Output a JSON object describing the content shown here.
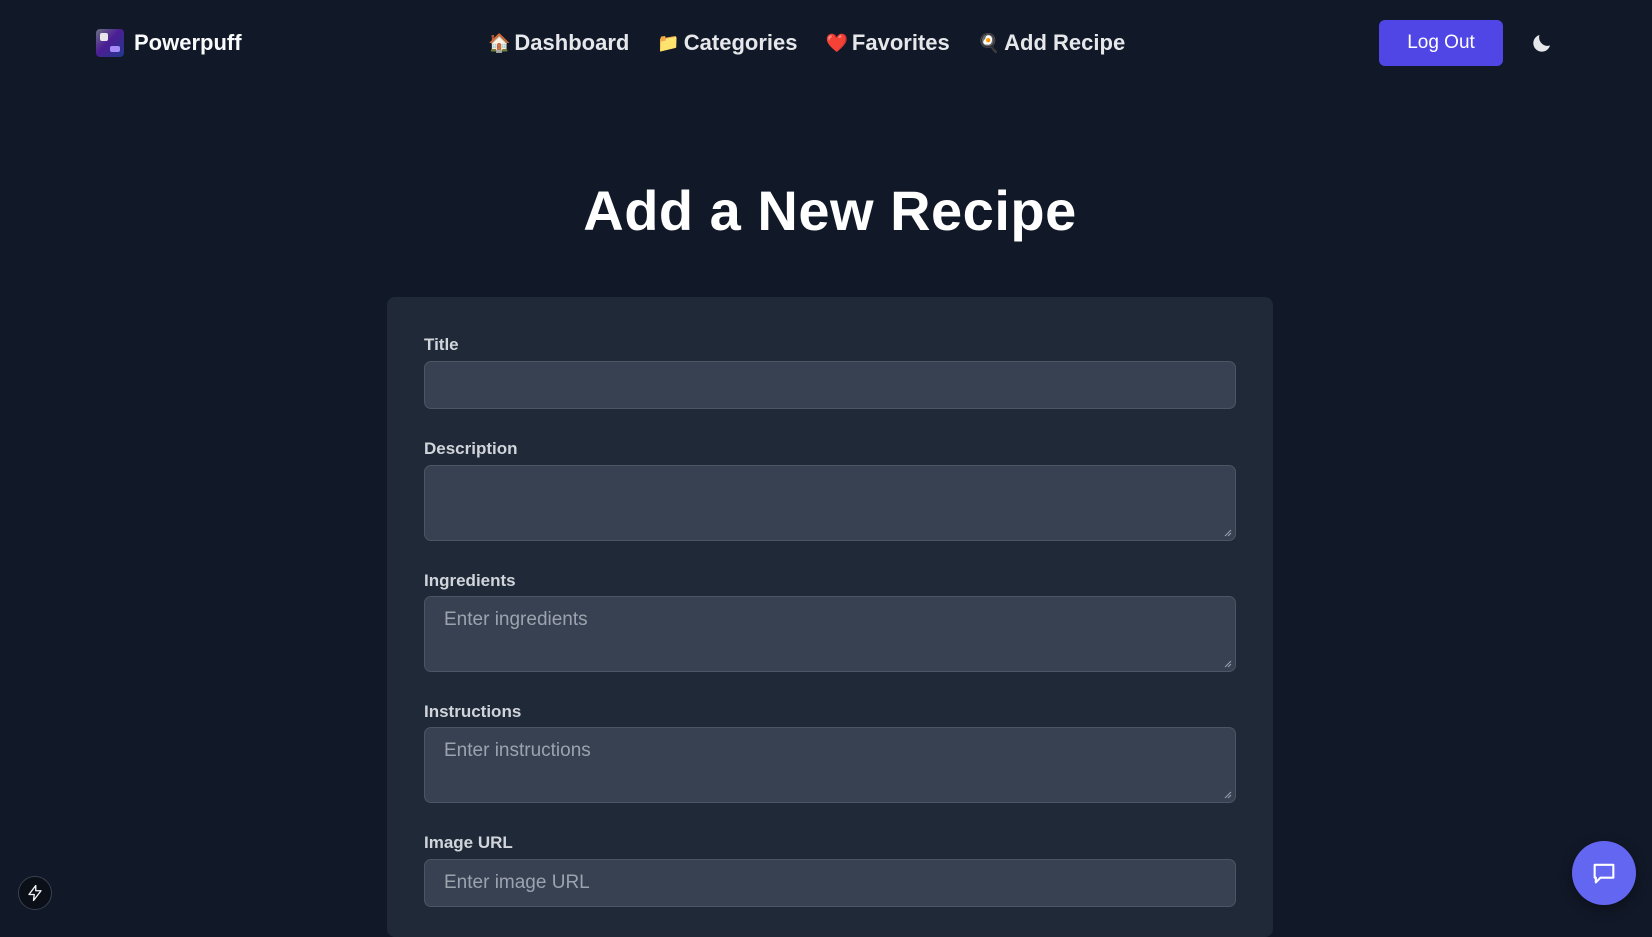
{
  "navbar": {
    "brand": {
      "name": "Powerpuff",
      "logo_icon": "powerpuff-logo"
    },
    "links": [
      {
        "icon": "🏠",
        "label": "Dashboard"
      },
      {
        "icon": "📁",
        "label": "Categories"
      },
      {
        "icon": "❤️",
        "label": "Favorites"
      },
      {
        "icon": "🍳",
        "label": "Add Recipe"
      }
    ],
    "logout_label": "Log Out",
    "theme_toggle_icon": "moon-icon"
  },
  "page": {
    "title": "Add a New Recipe"
  },
  "form": {
    "title": {
      "label": "Title",
      "value": "",
      "placeholder": ""
    },
    "description": {
      "label": "Description",
      "value": "",
      "placeholder": ""
    },
    "ingredients": {
      "label": "Ingredients",
      "value": "",
      "placeholder": "Enter ingredients"
    },
    "instructions": {
      "label": "Instructions",
      "value": "",
      "placeholder": "Enter instructions"
    },
    "image_url": {
      "label": "Image URL",
      "value": "",
      "placeholder": "Enter image URL"
    }
  },
  "floating": {
    "bolt_icon": "lightning-bolt-icon",
    "chat_icon": "chat-bubble-icon"
  },
  "colors": {
    "background": "#111827",
    "card": "#1f2937",
    "input": "#374151",
    "accent": "#4f46e5",
    "chat_button": "#6366f1"
  }
}
